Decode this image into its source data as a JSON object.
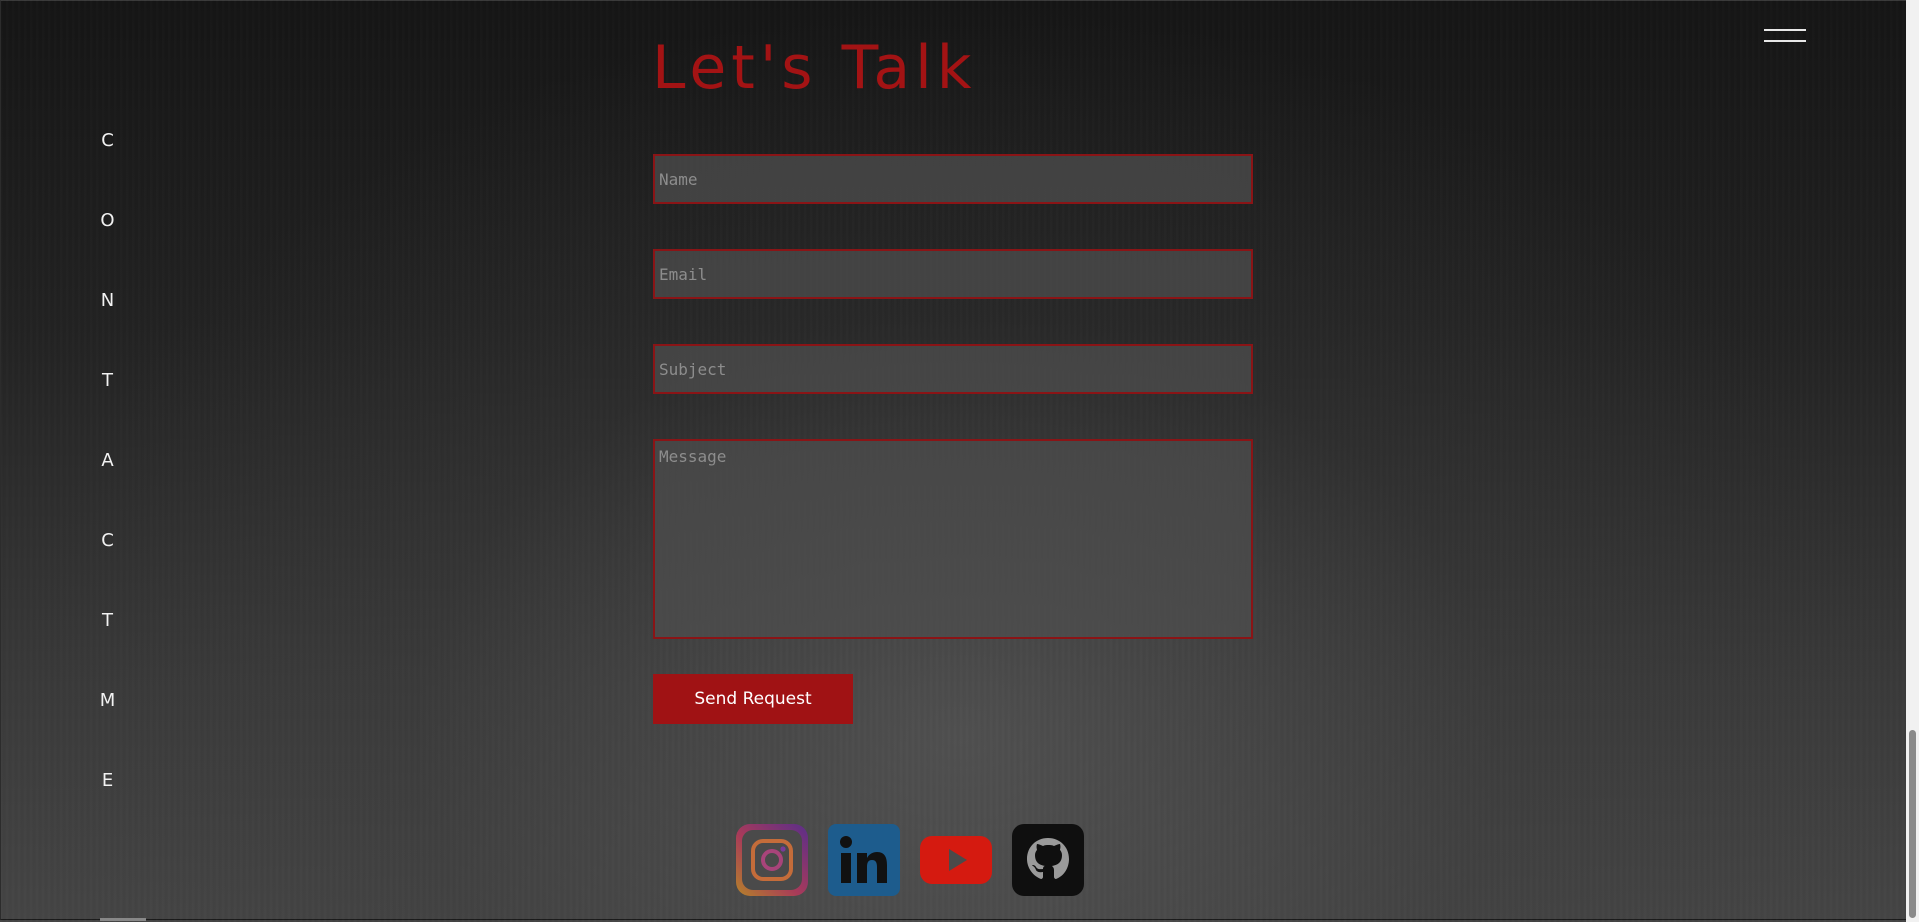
{
  "sidebar": {
    "letters": [
      "C",
      "O",
      "N",
      "T",
      "A",
      "C",
      "T",
      "M",
      "E"
    ]
  },
  "header": {
    "title": "Let's Talk",
    "menu_icon": "hamburger-menu-icon"
  },
  "form": {
    "name_placeholder": "Name",
    "email_placeholder": "Email",
    "subject_placeholder": "Subject",
    "message_placeholder": "Message",
    "submit_label": "Send Request"
  },
  "socials": [
    {
      "name": "instagram",
      "icon": "instagram-icon"
    },
    {
      "name": "linkedin",
      "icon": "linkedin-icon"
    },
    {
      "name": "youtube",
      "icon": "youtube-icon"
    },
    {
      "name": "github",
      "icon": "github-icon"
    }
  ],
  "colors": {
    "accent": "#a31314",
    "field_border": "#8a1416",
    "button": "#a01214",
    "background": "#2b2b2b"
  }
}
